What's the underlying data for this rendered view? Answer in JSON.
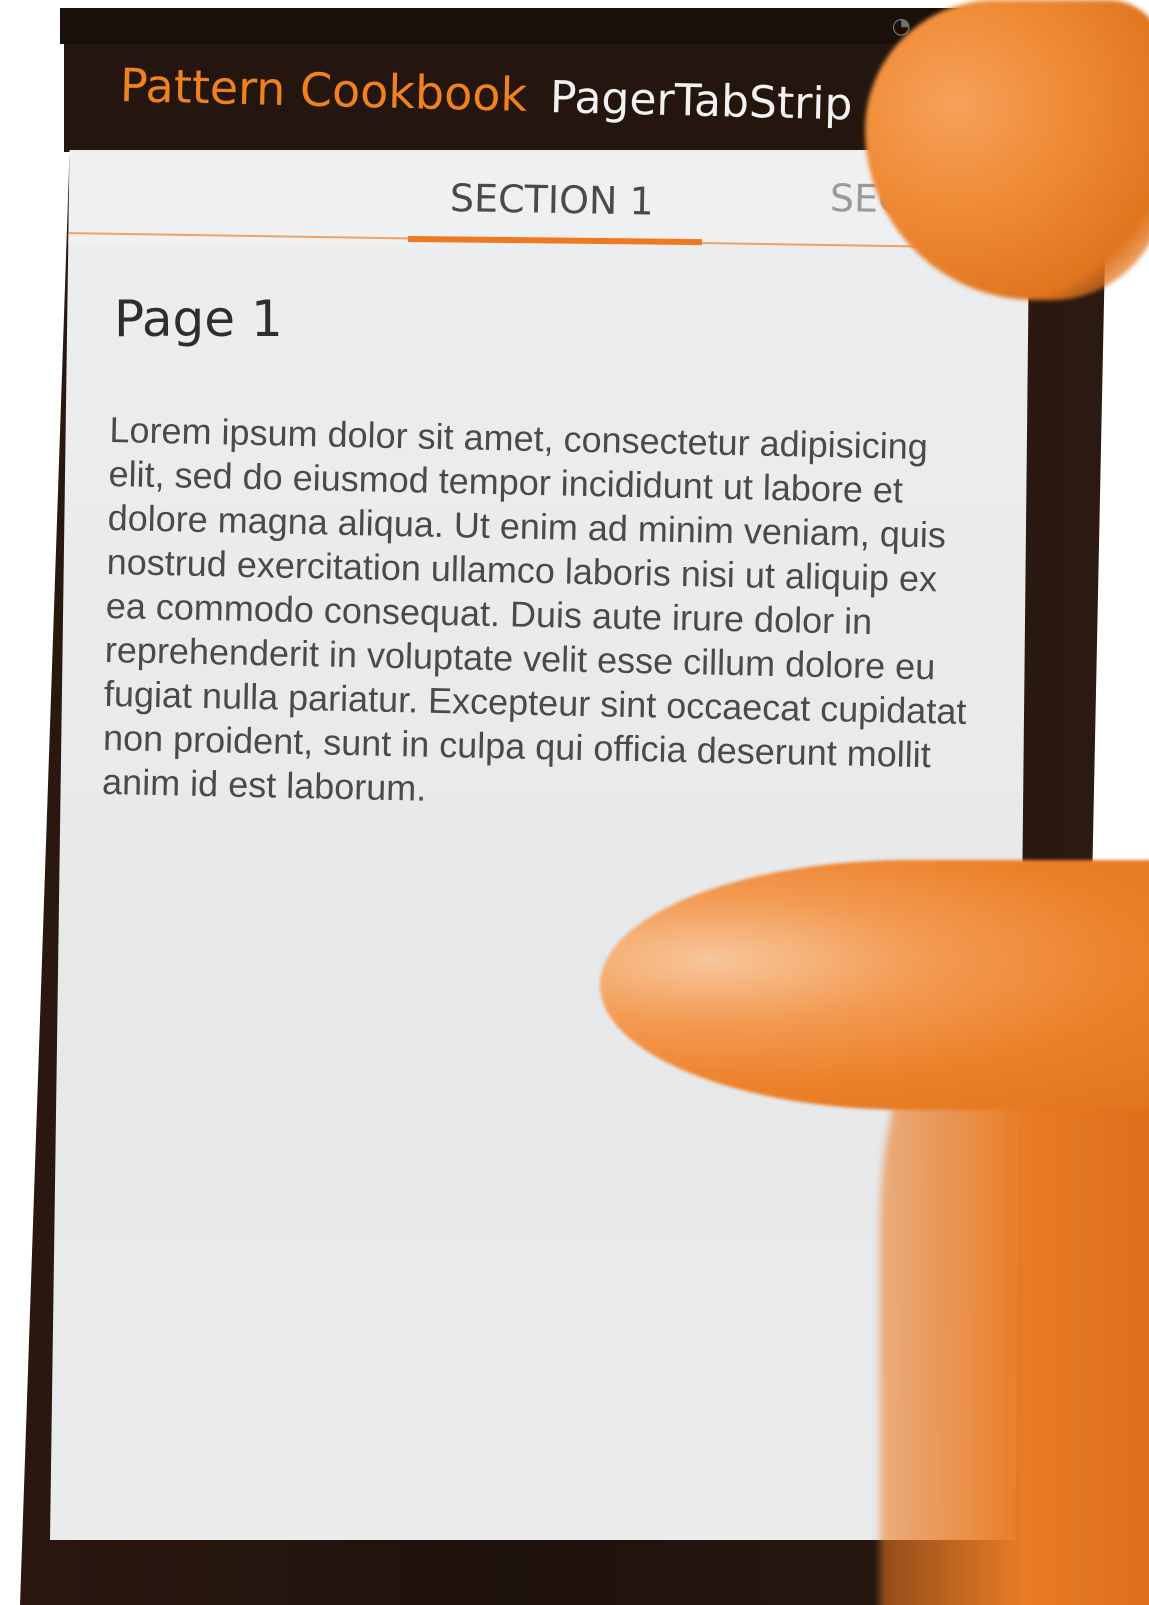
{
  "status_bar": {
    "icons": [
      "notification-icons"
    ]
  },
  "action_bar": {
    "app_title": "Pattern Cookbook",
    "screen_title": "PagerTabStrip"
  },
  "tabs": [
    {
      "label": "SECTION 1",
      "selected": true
    },
    {
      "label": "SECT",
      "selected": false
    }
  ],
  "page": {
    "heading": "Page 1",
    "body": "Lorem ipsum dolor sit amet, consectetur adipisicing elit, sed do eiusmod tempor incididunt ut labore et dolore magna aliqua. Ut enim ad minim veniam, quis nostrud exercitation ullamco laboris nisi ut aliquip ex ea commodo consequat. Duis aute irure dolor in reprehenderit in voluptate velit esse cillum dolore eu fugiat nulla pariatur. Excepteur sint occaecat cupidatat non proident, sunt in culpa qui officia deserunt mollit anim id est laborum."
  },
  "colors": {
    "accent": "#f07820",
    "action_bar_bg": "#24160f",
    "screen_bg": "#eceef0"
  }
}
